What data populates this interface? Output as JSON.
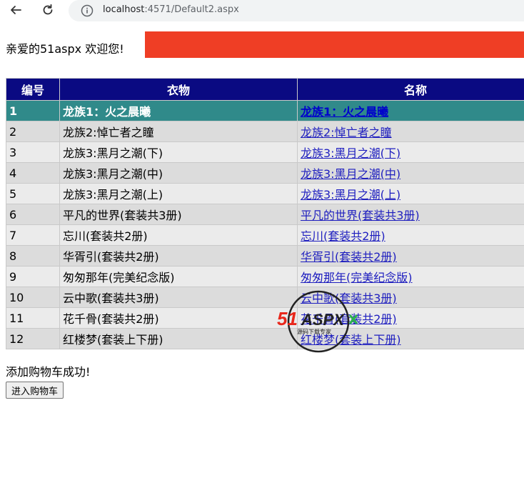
{
  "browser": {
    "url_host": "localhost",
    "url_path": ":4571/Default2.aspx"
  },
  "page": {
    "welcome_text": "亲爱的51aspx 欢迎您!",
    "banner_color": "#ef3e25",
    "table": {
      "headers": [
        "编号",
        "衣物",
        "名称"
      ],
      "rows": [
        {
          "id": "1",
          "clothing": "龙族1：火之晨曦",
          "name": "龙族1：火之晨曦",
          "selected": true
        },
        {
          "id": "2",
          "clothing": "龙族2:悼亡者之瞳",
          "name": "龙族2:悼亡者之瞳"
        },
        {
          "id": "3",
          "clothing": "龙族3:黑月之潮(下)",
          "name": "龙族3:黑月之潮(下)"
        },
        {
          "id": "4",
          "clothing": "龙族3:黑月之潮(中)",
          "name": "龙族3:黑月之潮(中)"
        },
        {
          "id": "5",
          "clothing": "龙族3:黑月之潮(上)",
          "name": "龙族3:黑月之潮(上)"
        },
        {
          "id": "6",
          "clothing": "平凡的世界(套装共3册)",
          "name": "平凡的世界(套装共3册)"
        },
        {
          "id": "7",
          "clothing": "忘川(套装共2册)",
          "name": "忘川(套装共2册)"
        },
        {
          "id": "8",
          "clothing": "华胥引(套装共2册)",
          "name": "华胥引(套装共2册)"
        },
        {
          "id": "9",
          "clothing": "匆匆那年(完美纪念版)",
          "name": "匆匆那年(完美纪念版)"
        },
        {
          "id": "10",
          "clothing": "云中歌(套装共3册)",
          "name": "云中歌(套装共3册)"
        },
        {
          "id": "11",
          "clothing": "花千骨(套装共2册)",
          "name": "花千骨(套装共2册)"
        },
        {
          "id": "12",
          "clothing": "红楼梦(套装上下册)",
          "name": "红楼梦(套装上下册)"
        }
      ],
      "header_color": "#0a0a82",
      "selected_color": "#308a8a"
    },
    "success_text": "添加购物车成功!",
    "cart_button_label": "进入购物车"
  },
  "watermark": {
    "brand": "51aspx",
    "text_51": "51",
    "text_aspx": "ASPX",
    "tagline": "源码下载专家"
  }
}
